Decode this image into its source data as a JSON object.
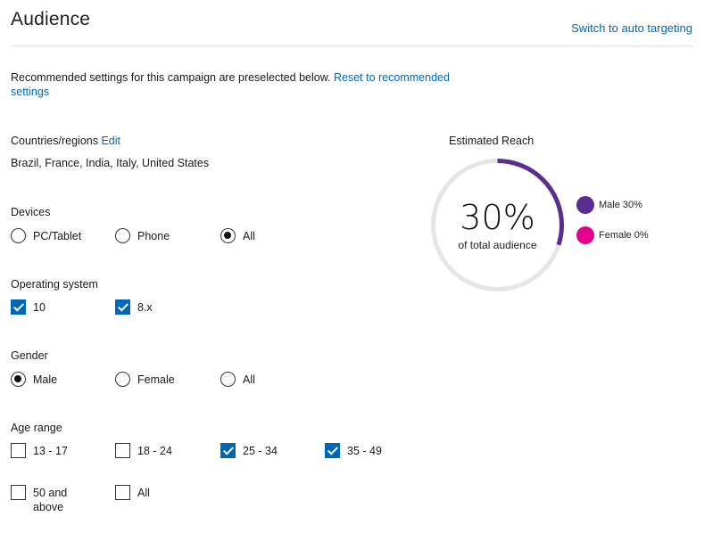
{
  "header": {
    "title": "Audience",
    "switch_link": "Switch to auto targeting"
  },
  "recommend": {
    "text": "Recommended settings for this campaign are preselected below. ",
    "reset_link": "Reset to recommended settings"
  },
  "countries": {
    "label": "Countries/regions",
    "edit_link": "Edit",
    "value": "Brazil, France, India, Italy, United States"
  },
  "devices": {
    "label": "Devices",
    "options": [
      {
        "label": "PC/Tablet",
        "selected": false
      },
      {
        "label": "Phone",
        "selected": false
      },
      {
        "label": "All",
        "selected": true
      }
    ]
  },
  "os": {
    "label": "Operating system",
    "options": [
      {
        "label": "10",
        "checked": true
      },
      {
        "label": "8.x",
        "checked": true
      }
    ]
  },
  "gender": {
    "label": "Gender",
    "options": [
      {
        "label": "Male",
        "selected": true
      },
      {
        "label": "Female",
        "selected": false
      },
      {
        "label": "All",
        "selected": false
      }
    ]
  },
  "age": {
    "label": "Age range",
    "options": [
      {
        "label": "13 - 17",
        "checked": false
      },
      {
        "label": "18 - 24",
        "checked": false
      },
      {
        "label": "25 - 34",
        "checked": true
      },
      {
        "label": "35 - 49",
        "checked": true
      },
      {
        "label": "50 and above",
        "checked": false
      },
      {
        "label": "All",
        "checked": false
      }
    ]
  },
  "reach": {
    "label": "Estimated Reach",
    "percent": "30%",
    "subtitle": "of total audience",
    "fraction": 0.3,
    "track_color": "#e6e6e6",
    "fill_color": "#5c2d91",
    "legend": [
      {
        "label": "Male 30%",
        "color": "#5c2d91"
      },
      {
        "label": "Female 0%",
        "color": "#e3008c"
      }
    ]
  }
}
